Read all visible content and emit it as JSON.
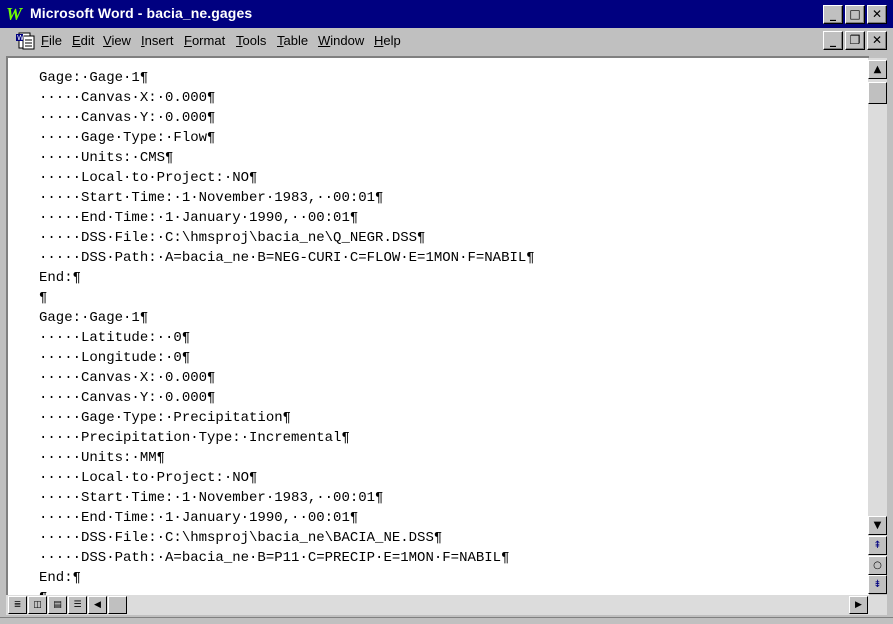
{
  "window": {
    "title": "Microsoft Word - bacia_ne.gages",
    "app_icon": "W"
  },
  "title_buttons": {
    "minimize": "_",
    "maximize": "□",
    "close": "✕"
  },
  "menu": {
    "items": [
      {
        "u": "F",
        "rest": "ile"
      },
      {
        "u": "E",
        "rest": "dit"
      },
      {
        "u": "V",
        "rest": "iew"
      },
      {
        "u": "I",
        "rest": "nsert"
      },
      {
        "u": "F",
        "rest": "ormat",
        "pre": ""
      },
      {
        "u": "T",
        "rest": "ools"
      },
      {
        "u": "T",
        "rest": "able",
        "pre": ""
      },
      {
        "u": "W",
        "rest": "indow"
      },
      {
        "u": "H",
        "rest": "elp"
      }
    ]
  },
  "doc_buttons": {
    "minimize": "_",
    "restore": "❐",
    "close": "✕"
  },
  "document": {
    "lines": [
      "Gage:·Gage·1¶",
      "·····Canvas·X:·0.000¶",
      "·····Canvas·Y:·0.000¶",
      "·····Gage·Type:·Flow¶",
      "·····Units:·CMS¶",
      "·····Local·to·Project:·NO¶",
      "·····Start·Time:·1·November·1983,··00:01¶",
      "·····End·Time:·1·January·1990,··00:01¶",
      "·····DSS·File:·C:\\hmsproj\\bacia_ne\\Q_NEGR.DSS¶",
      "·····DSS·Path:·A=bacia_ne·B=NEG-CURI·C=FLOW·E=1MON·F=NABIL¶",
      "End:¶",
      "¶",
      "Gage:·Gage·1¶",
      "·····Latitude:··0¶",
      "·····Longitude:·0¶",
      "·····Canvas·X:·0.000¶",
      "·····Canvas·Y:·0.000¶",
      "·····Gage·Type:·Precipitation¶",
      "·····Precipitation·Type:·Incremental¶",
      "·····Units:·MM¶",
      "·····Local·to·Project:·NO¶",
      "·····Start·Time:·1·November·1983,··00:01¶",
      "·····End·Time:·1·January·1990,··00:01¶",
      "·····DSS·File:·C:\\hmsproj\\bacia_ne\\BACIA_NE.DSS¶",
      "·····DSS·Path:·A=bacia_ne·B=P11·C=PRECIP·E=1MON·F=NABIL¶",
      "End:¶",
      "¶"
    ]
  },
  "scrollbar": {
    "up": "▲",
    "down": "▼",
    "prev_page": "⇞",
    "select_browse": "○",
    "next_page": "⇟"
  },
  "hscroll": {
    "left": "◀",
    "right": "▶"
  },
  "view_buttons": [
    "≣",
    "◫",
    "▤",
    "☰"
  ]
}
